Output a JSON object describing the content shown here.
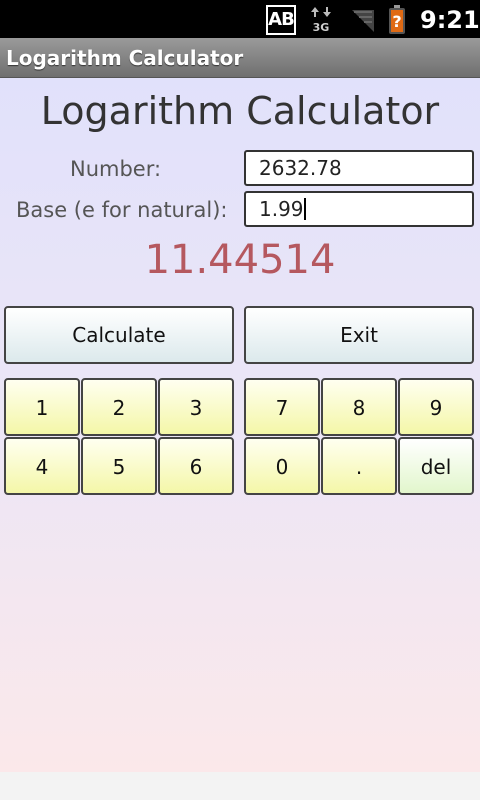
{
  "status_bar": {
    "notification_label": "AB",
    "network_type": "3G",
    "time": "9:21",
    "icons": [
      "ab-notification-icon",
      "3g-data-icon",
      "signal-icon",
      "battery-icon"
    ]
  },
  "title_bar": {
    "title": "Logarithm Calculator"
  },
  "main": {
    "heading": "Logarithm Calculator",
    "number_label": "Number:",
    "number_value": "2632.78",
    "base_label": "Base (e for natural):",
    "base_value": "1.99",
    "result": "11.44514"
  },
  "buttons": {
    "calculate": "Calculate",
    "exit": "Exit"
  },
  "keypad": {
    "left": [
      "1",
      "2",
      "3",
      "4",
      "5",
      "6"
    ],
    "right": [
      "7",
      "8",
      "9",
      "0",
      ".",
      "del"
    ]
  },
  "colors": {
    "result_text": "#b5585f",
    "key_background": "#f4f7a8",
    "del_key_background": "#e2f6cc",
    "action_button_background": "#dce9ec",
    "content_background_top": "#e1e1fb",
    "content_background_bottom": "#fbe8ea"
  }
}
